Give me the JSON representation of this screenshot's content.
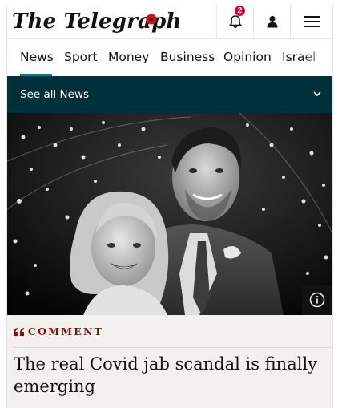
{
  "header": {
    "logo_text": "The Telegraph",
    "notifications_count": "2",
    "icons": [
      "bell-icon",
      "account-icon",
      "menu-icon"
    ]
  },
  "nav": {
    "items": [
      {
        "label": "News"
      },
      {
        "label": "Sport"
      },
      {
        "label": "Money"
      },
      {
        "label": "Business"
      },
      {
        "label": "Opinion"
      },
      {
        "label": "Israel"
      }
    ],
    "active_index": 0,
    "accent_color": "#0b7b8a"
  },
  "section": {
    "label": "See all News",
    "background_color": "#00303a"
  },
  "article": {
    "kicker": "COMMENT",
    "headline": "The real Covid jab scandal is finally emerging",
    "kicker_color": "#7a1414"
  }
}
